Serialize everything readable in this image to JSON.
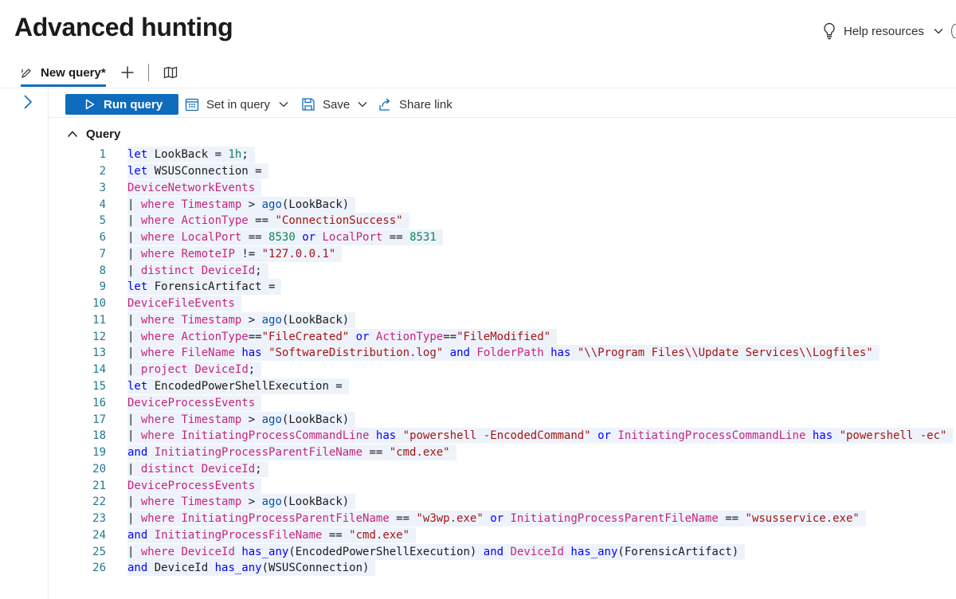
{
  "page": {
    "title": "Advanced hunting"
  },
  "header": {
    "help_label": "Help resources",
    "help_icon": "lightbulb-icon"
  },
  "tabs": [
    {
      "label": "New query*",
      "icon": "query-tab-icon",
      "active": true
    }
  ],
  "tab_actions": {
    "add_icon": "plus-icon",
    "schema_icon": "book-map-icon"
  },
  "toolbar": {
    "run_label": "Run query",
    "set_in_query_label": "Set in query",
    "save_label": "Save",
    "share_label": "Share link"
  },
  "section": {
    "query_label": "Query"
  },
  "colors": {
    "accent": "#0f6cbd",
    "keyword": "#0000ff",
    "table": "#c5257e",
    "string": "#a31515",
    "number": "#098658",
    "line_number": "#237893"
  },
  "code_lines": [
    [
      [
        "kw",
        "let"
      ],
      [
        "tx",
        " LookBack = "
      ],
      [
        "num",
        "1h"
      ],
      [
        "tx",
        ";"
      ]
    ],
    [
      [
        "kw",
        "let"
      ],
      [
        "tx",
        " WSUSConnection ="
      ]
    ],
    [
      [
        "tb",
        "DeviceNetworkEvents"
      ]
    ],
    [
      [
        "tx",
        "| "
      ],
      [
        "tb",
        "where"
      ],
      [
        "tx",
        " "
      ],
      [
        "tb",
        "Timestamp"
      ],
      [
        "tx",
        " > "
      ],
      [
        "fn",
        "ago"
      ],
      [
        "tx",
        "(LookBack)"
      ]
    ],
    [
      [
        "tx",
        "| "
      ],
      [
        "tb",
        "where"
      ],
      [
        "tx",
        " "
      ],
      [
        "tb",
        "ActionType"
      ],
      [
        "tx",
        " == "
      ],
      [
        "str",
        "\"ConnectionSuccess\""
      ]
    ],
    [
      [
        "tx",
        "| "
      ],
      [
        "tb",
        "where"
      ],
      [
        "tx",
        " "
      ],
      [
        "tb",
        "LocalPort"
      ],
      [
        "tx",
        " == "
      ],
      [
        "num",
        "8530"
      ],
      [
        "tx",
        " "
      ],
      [
        "kw",
        "or"
      ],
      [
        "tx",
        " "
      ],
      [
        "tb",
        "LocalPort"
      ],
      [
        "tx",
        " == "
      ],
      [
        "num",
        "8531"
      ]
    ],
    [
      [
        "tx",
        "| "
      ],
      [
        "tb",
        "where"
      ],
      [
        "tx",
        " "
      ],
      [
        "tb",
        "RemoteIP"
      ],
      [
        "tx",
        " != "
      ],
      [
        "str",
        "\"127.0.0.1\""
      ]
    ],
    [
      [
        "tx",
        "| "
      ],
      [
        "tb",
        "distinct"
      ],
      [
        "tx",
        " "
      ],
      [
        "tb",
        "DeviceId"
      ],
      [
        "tx",
        ";"
      ]
    ],
    [
      [
        "kw",
        "let"
      ],
      [
        "tx",
        " ForensicArtifact ="
      ]
    ],
    [
      [
        "tb",
        "DeviceFileEvents"
      ]
    ],
    [
      [
        "tx",
        "| "
      ],
      [
        "tb",
        "where"
      ],
      [
        "tx",
        " "
      ],
      [
        "tb",
        "Timestamp"
      ],
      [
        "tx",
        " > "
      ],
      [
        "fn",
        "ago"
      ],
      [
        "tx",
        "(LookBack)"
      ]
    ],
    [
      [
        "tx",
        "| "
      ],
      [
        "tb",
        "where"
      ],
      [
        "tx",
        " "
      ],
      [
        "tb",
        "ActionType"
      ],
      [
        "tx",
        "=="
      ],
      [
        "str",
        "\"FileCreated\""
      ],
      [
        "tx",
        " "
      ],
      [
        "kw",
        "or"
      ],
      [
        "tx",
        " "
      ],
      [
        "tb",
        "ActionType"
      ],
      [
        "tx",
        "=="
      ],
      [
        "str",
        "\"FileModified\""
      ]
    ],
    [
      [
        "tx",
        "| "
      ],
      [
        "tb",
        "where"
      ],
      [
        "tx",
        " "
      ],
      [
        "tb",
        "FileName"
      ],
      [
        "tx",
        " "
      ],
      [
        "kw",
        "has"
      ],
      [
        "tx",
        " "
      ],
      [
        "str",
        "\"SoftwareDistribution.log\""
      ],
      [
        "tx",
        " "
      ],
      [
        "kw",
        "and"
      ],
      [
        "tx",
        " "
      ],
      [
        "tb",
        "FolderPath"
      ],
      [
        "tx",
        " "
      ],
      [
        "kw",
        "has"
      ],
      [
        "tx",
        " "
      ],
      [
        "str",
        "\"\\\\Program Files\\\\Update Services\\\\Logfiles\""
      ]
    ],
    [
      [
        "tx",
        "| "
      ],
      [
        "tb",
        "project"
      ],
      [
        "tx",
        " "
      ],
      [
        "tb",
        "DeviceId"
      ],
      [
        "tx",
        ";"
      ]
    ],
    [
      [
        "kw",
        "let"
      ],
      [
        "tx",
        " EncodedPowerShellExecution ="
      ]
    ],
    [
      [
        "tb",
        "DeviceProcessEvents"
      ]
    ],
    [
      [
        "tx",
        "| "
      ],
      [
        "tb",
        "where"
      ],
      [
        "tx",
        " "
      ],
      [
        "tb",
        "Timestamp"
      ],
      [
        "tx",
        " > "
      ],
      [
        "fn",
        "ago"
      ],
      [
        "tx",
        "(LookBack)"
      ]
    ],
    [
      [
        "tx",
        "| "
      ],
      [
        "tb",
        "where"
      ],
      [
        "tx",
        " "
      ],
      [
        "tb",
        "InitiatingProcessCommandLine"
      ],
      [
        "tx",
        " "
      ],
      [
        "kw",
        "has"
      ],
      [
        "tx",
        " "
      ],
      [
        "str",
        "\"powershell -EncodedCommand\""
      ],
      [
        "tx",
        " "
      ],
      [
        "kw",
        "or"
      ],
      [
        "tx",
        " "
      ],
      [
        "tb",
        "InitiatingProcessCommandLine"
      ],
      [
        "tx",
        " "
      ],
      [
        "kw",
        "has"
      ],
      [
        "tx",
        " "
      ],
      [
        "str",
        "\"powershell -ec\""
      ]
    ],
    [
      [
        "kw",
        "and"
      ],
      [
        "tx",
        " "
      ],
      [
        "tb",
        "InitiatingProcessParentFileName"
      ],
      [
        "tx",
        " == "
      ],
      [
        "str",
        "\"cmd.exe\""
      ]
    ],
    [
      [
        "tx",
        "| "
      ],
      [
        "tb",
        "distinct"
      ],
      [
        "tx",
        " "
      ],
      [
        "tb",
        "DeviceId"
      ],
      [
        "tx",
        ";"
      ]
    ],
    [
      [
        "tb",
        "DeviceProcessEvents"
      ]
    ],
    [
      [
        "tx",
        "| "
      ],
      [
        "tb",
        "where"
      ],
      [
        "tx",
        " "
      ],
      [
        "tb",
        "Timestamp"
      ],
      [
        "tx",
        " > "
      ],
      [
        "fn",
        "ago"
      ],
      [
        "tx",
        "(LookBack)"
      ]
    ],
    [
      [
        "tx",
        "| "
      ],
      [
        "tb",
        "where"
      ],
      [
        "tx",
        " "
      ],
      [
        "tb",
        "InitiatingProcessParentFileName"
      ],
      [
        "tx",
        " == "
      ],
      [
        "str",
        "\"w3wp.exe\""
      ],
      [
        "tx",
        " "
      ],
      [
        "kw",
        "or"
      ],
      [
        "tx",
        " "
      ],
      [
        "tb",
        "InitiatingProcessParentFileName"
      ],
      [
        "tx",
        " == "
      ],
      [
        "str",
        "\"wsusservice.exe\""
      ]
    ],
    [
      [
        "kw",
        "and"
      ],
      [
        "tx",
        " "
      ],
      [
        "tb",
        "InitiatingProcessFileName"
      ],
      [
        "tx",
        " == "
      ],
      [
        "str",
        "\"cmd.exe\""
      ]
    ],
    [
      [
        "tx",
        "| "
      ],
      [
        "tb",
        "where"
      ],
      [
        "tx",
        " "
      ],
      [
        "tb",
        "DeviceId"
      ],
      [
        "tx",
        " "
      ],
      [
        "kw",
        "has_any"
      ],
      [
        "tx",
        "(EncodedPowerShellExecution) "
      ],
      [
        "kw",
        "and"
      ],
      [
        "tx",
        " "
      ],
      [
        "tb",
        "DeviceId"
      ],
      [
        "tx",
        " "
      ],
      [
        "kw",
        "has_any"
      ],
      [
        "tx",
        "(ForensicArtifact)"
      ]
    ],
    [
      [
        "kw",
        "and"
      ],
      [
        "tx",
        " DeviceId "
      ],
      [
        "kw",
        "has_any"
      ],
      [
        "tx",
        "(WSUSConnection)"
      ]
    ]
  ]
}
